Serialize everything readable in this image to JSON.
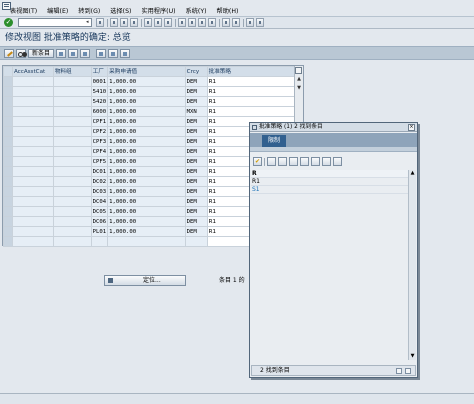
{
  "menu": {
    "items": [
      "表视图(T)",
      "编辑(E)",
      "转到(G)",
      "选择(S)",
      "实用程序(U)",
      "系统(Y)",
      "帮助(H)"
    ]
  },
  "toolbar": {
    "command_value": ""
  },
  "page": {
    "title": "修改视图 批准策略的确定: 总览"
  },
  "app_toolbar": {
    "new_entries_label": "新条目"
  },
  "table": {
    "columns": [
      "AccAsstCat",
      "物料组",
      "工厂",
      "采购申请值",
      "Crcy",
      "批准策略"
    ],
    "rows": [
      [
        "",
        "",
        "0001",
        "1,000.00",
        "DEM",
        "R1"
      ],
      [
        "",
        "",
        "5410",
        "1,000.00",
        "DEM",
        "R1"
      ],
      [
        "",
        "",
        "5420",
        "1,000.00",
        "DEM",
        "R1"
      ],
      [
        "",
        "",
        "6000",
        "1,000.00",
        "MXN",
        "R1"
      ],
      [
        "",
        "",
        "CPF1",
        "1,000.00",
        "DEM",
        "R1"
      ],
      [
        "",
        "",
        "CPF2",
        "1,000.00",
        "DEM",
        "R1"
      ],
      [
        "",
        "",
        "CPF3",
        "1,000.00",
        "DEM",
        "R1"
      ],
      [
        "",
        "",
        "CPF4",
        "1,000.00",
        "DEM",
        "R1"
      ],
      [
        "",
        "",
        "CPF5",
        "1,000.00",
        "DEM",
        "R1"
      ],
      [
        "",
        "",
        "DC01",
        "1,000.00",
        "DEM",
        "R1"
      ],
      [
        "",
        "",
        "DC02",
        "1,000.00",
        "DEM",
        "R1"
      ],
      [
        "",
        "",
        "DC03",
        "1,000.00",
        "DEM",
        "R1"
      ],
      [
        "",
        "",
        "DC04",
        "1,000.00",
        "DEM",
        "R1"
      ],
      [
        "",
        "",
        "DC05",
        "1,000.00",
        "DEM",
        "R1"
      ],
      [
        "",
        "",
        "DC06",
        "1,000.00",
        "DEM",
        "R1"
      ],
      [
        "",
        "",
        "PL01",
        "1,000.00",
        "DEM",
        "R1"
      ],
      [
        "",
        "",
        "",
        "",
        "",
        ""
      ]
    ]
  },
  "footer": {
    "position_label": "定位...",
    "entry_count": "条目 1 的"
  },
  "popup": {
    "title": "批准策略 (1)   2 找到条目",
    "tab_label": "限制",
    "list_header": "R",
    "list_items": [
      "R1",
      "S1"
    ],
    "status": "2 找到条目"
  }
}
